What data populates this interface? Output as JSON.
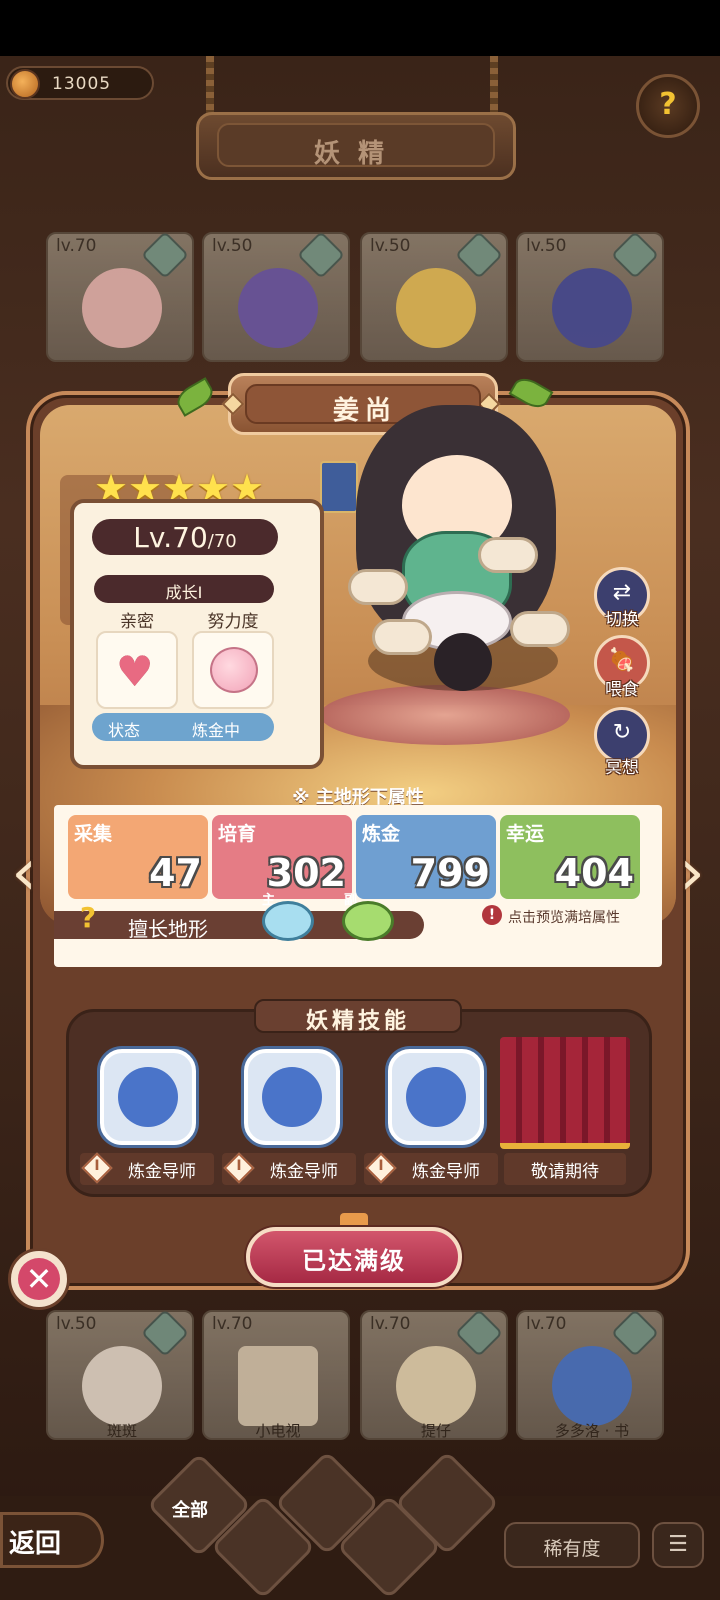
{
  "header": {
    "currency_value": "13005",
    "page_title": "妖精"
  },
  "background_cards_top": [
    {
      "level": "lv.70"
    },
    {
      "level": "lv.50"
    },
    {
      "level": "lv.50"
    },
    {
      "level": "lv.50"
    }
  ],
  "background_cards_bottom": [
    {
      "level": "lv.50",
      "name": "斑斑"
    },
    {
      "level": "lv.70",
      "name": "小电视"
    },
    {
      "level": "lv.70",
      "name": "提仔"
    },
    {
      "level": "lv.70",
      "name": "多多洛 · 书"
    }
  ],
  "fairy": {
    "name": "姜尚",
    "star_count": 5,
    "level": "Lv.70",
    "level_max": "/70",
    "growth": "成长I",
    "intimacy_label": "亲密",
    "effort_label": "努力度",
    "status_label": "状态",
    "status_value": "炼金中"
  },
  "side_actions": {
    "switch": "切换",
    "feed": "喂食",
    "meditate": "冥想"
  },
  "attributes": {
    "heading": "※ 主地形下属性",
    "items": [
      {
        "name": "采集",
        "value": "47",
        "color": "#f3a774",
        "text_color": "#ffffff"
      },
      {
        "name": "培育",
        "value": "302",
        "color": "#e57c85",
        "text_color": "#ffffff"
      },
      {
        "name": "炼金",
        "value": "799",
        "color": "#6f9fd1",
        "text_color": "#ffffff"
      },
      {
        "name": "幸运",
        "value": "404",
        "color": "#8ebf5e",
        "text_color": "#ffffff"
      }
    ],
    "terrain_label": "擅长地形",
    "terrain_main_tag": "主",
    "terrain_sub_tag": "副",
    "preview_hint": "点击预览满培属性"
  },
  "skills": {
    "title": "妖精技能",
    "items": [
      {
        "num": "I",
        "label": "炼金导师"
      },
      {
        "num": "I",
        "label": "炼金导师"
      },
      {
        "num": "I",
        "label": "炼金导师"
      }
    ],
    "locked_label": "敬请期待"
  },
  "max_level_button": "已达满级",
  "bottom_nav": {
    "back": "返回",
    "filter_all": "全部",
    "rarity": "稀有度"
  },
  "colors": {
    "panel_border": "#c78a5a",
    "status_bar": "#6ea4ce",
    "max_button": "#a62944"
  }
}
